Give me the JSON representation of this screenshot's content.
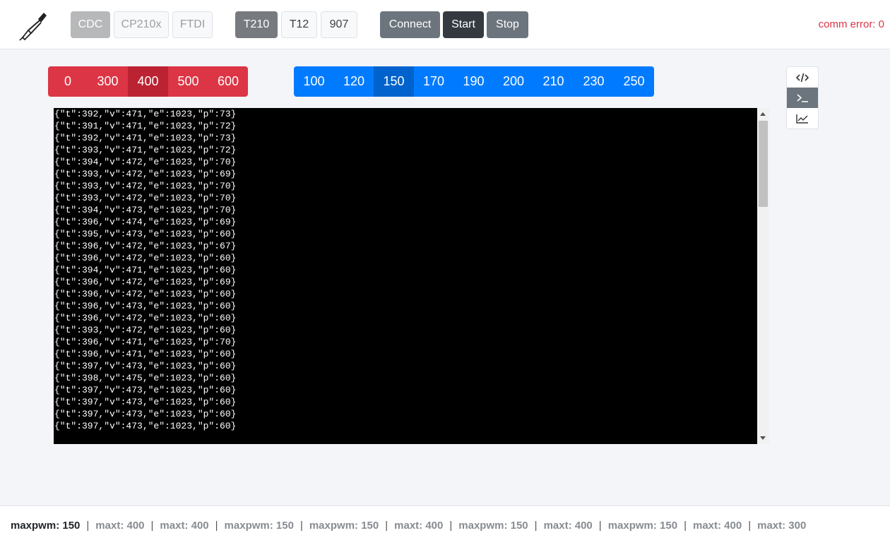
{
  "header": {
    "drivers": [
      {
        "label": "CDC",
        "state": "active"
      },
      {
        "label": "CP210x",
        "state": "inactive"
      },
      {
        "label": "FTDI",
        "state": "inactive"
      }
    ],
    "tips": [
      {
        "label": "T210",
        "state": "active"
      },
      {
        "label": "T12",
        "state": "inactive"
      },
      {
        "label": "907",
        "state": "inactive"
      }
    ],
    "connect_label": "Connect",
    "start_label": "Start",
    "stop_label": "Stop",
    "comm_error": "comm error: 0"
  },
  "temps": {
    "values": [
      "0",
      "300",
      "400",
      "500",
      "600"
    ],
    "selected": "400"
  },
  "pwms": {
    "values": [
      "100",
      "120",
      "150",
      "170",
      "190",
      "200",
      "210",
      "230",
      "250"
    ],
    "selected": "150"
  },
  "view_buttons": [
    {
      "icon": "code-icon",
      "state": "inactive"
    },
    {
      "icon": "terminal-icon",
      "state": "active"
    },
    {
      "icon": "chart-line-icon",
      "state": "inactive"
    }
  ],
  "console_lines": [
    "{\"t\":392,\"v\":471,\"e\":1023,\"p\":73}",
    "{\"t\":391,\"v\":471,\"e\":1023,\"p\":72}",
    "{\"t\":392,\"v\":471,\"e\":1023,\"p\":73}",
    "{\"t\":393,\"v\":471,\"e\":1023,\"p\":72}",
    "{\"t\":394,\"v\":472,\"e\":1023,\"p\":70}",
    "{\"t\":393,\"v\":472,\"e\":1023,\"p\":69}",
    "{\"t\":393,\"v\":472,\"e\":1023,\"p\":70}",
    "{\"t\":393,\"v\":472,\"e\":1023,\"p\":70}",
    "{\"t\":394,\"v\":473,\"e\":1023,\"p\":70}",
    "{\"t\":396,\"v\":474,\"e\":1023,\"p\":69}",
    "{\"t\":395,\"v\":473,\"e\":1023,\"p\":60}",
    "{\"t\":396,\"v\":472,\"e\":1023,\"p\":67}",
    "{\"t\":396,\"v\":472,\"e\":1023,\"p\":60}",
    "{\"t\":394,\"v\":471,\"e\":1023,\"p\":60}",
    "{\"t\":396,\"v\":472,\"e\":1023,\"p\":69}",
    "{\"t\":396,\"v\":472,\"e\":1023,\"p\":60}",
    "{\"t\":396,\"v\":473,\"e\":1023,\"p\":60}",
    "{\"t\":396,\"v\":472,\"e\":1023,\"p\":60}",
    "{\"t\":393,\"v\":472,\"e\":1023,\"p\":60}",
    "{\"t\":396,\"v\":471,\"e\":1023,\"p\":70}",
    "{\"t\":396,\"v\":471,\"e\":1023,\"p\":60}",
    "{\"t\":397,\"v\":473,\"e\":1023,\"p\":60}",
    "{\"t\":398,\"v\":475,\"e\":1023,\"p\":60}",
    "{\"t\":397,\"v\":473,\"e\":1023,\"p\":60}",
    "{\"t\":397,\"v\":473,\"e\":1023,\"p\":60}",
    "{\"t\":397,\"v\":473,\"e\":1023,\"p\":60}",
    "{\"t\":397,\"v\":473,\"e\":1023,\"p\":60}"
  ],
  "footer_items": [
    "maxpwm: 150",
    "maxt: 400",
    "maxt: 400",
    "maxpwm: 150",
    "maxpwm: 150",
    "maxt: 400",
    "maxpwm: 150",
    "maxt: 400",
    "maxpwm: 150",
    "maxt: 400",
    "maxt: 300"
  ],
  "colors": {
    "danger": "#dc3545",
    "primary": "#007bff",
    "secondary": "#6c757d",
    "dark": "#343a40"
  }
}
